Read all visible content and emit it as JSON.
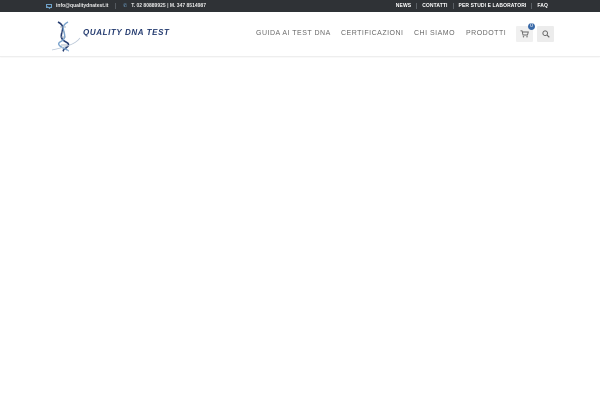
{
  "topbar": {
    "email": "info@qualitydnatest.it",
    "phone": "T. 02 80889925 | M. 347 8514987",
    "links": [
      "NEWS",
      "CONTATTI",
      "PER STUDI E LABORATORI",
      "FAQ"
    ]
  },
  "header": {
    "brand": "QUALITY DNA TEST",
    "nav": [
      "GUIDA AI TEST DNA",
      "CERTIFICAZIONI",
      "CHI SIAMO",
      "PRODOTTI"
    ],
    "cart_count": "0"
  },
  "icons": {
    "email": "mail-icon",
    "phone": "phone-icon",
    "cart": "cart-icon",
    "search": "search-icon",
    "logo": "dna-helix-logo-icon"
  },
  "colors": {
    "topbar_bg": "#2f3236",
    "accent": "#3a6aa8",
    "brand_text": "#253c70",
    "nav_text": "#6b6b6b"
  }
}
